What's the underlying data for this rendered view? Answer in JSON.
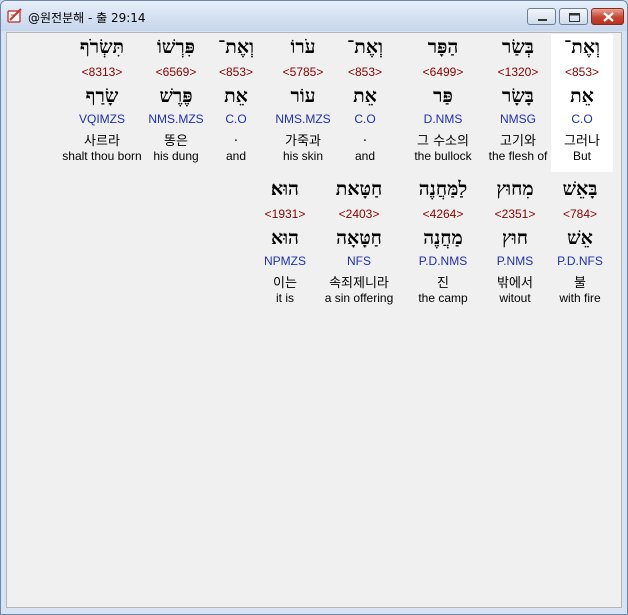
{
  "window": {
    "title": "@원전분해 - 출 29:14",
    "icon": "book-quill-icon",
    "controls": [
      "minimize-icon",
      "maximize-icon",
      "close-icon"
    ],
    "close_color": "#c64431"
  },
  "rows": [
    {
      "words": [
        {
          "hebrew": "וְאֶת־",
          "strong": "<853>",
          "lemma": "אֵת",
          "morph": "C.O",
          "korean": "그러나",
          "english": "But",
          "selected": true
        },
        {
          "hebrew": "בְּשַׂר",
          "strong": "<1320>",
          "lemma": "בָּשָׂר",
          "morph": "NMSG",
          "korean": "고기와",
          "english": "the flesh of",
          "selected": false
        },
        {
          "hebrew": "הַפָּר",
          "strong": "<6499>",
          "lemma": "פַּר",
          "morph": "D.NMS",
          "korean": "그 수소의",
          "english": "the bullock",
          "selected": false
        },
        {
          "hebrew": "וְאֶת־",
          "strong": "<853>",
          "lemma": "אֵת",
          "morph": "C.O",
          "korean": ".",
          "english": "and",
          "selected": false
        },
        {
          "hebrew": "עֹרוֹ",
          "strong": "<5785>",
          "lemma": "עוֹר",
          "morph": "NMS.MZS",
          "korean": "가죽과",
          "english": "his skin",
          "selected": false
        },
        {
          "hebrew": "וְאֶת־",
          "strong": "<853>",
          "lemma": "אֵת",
          "morph": "C.O",
          "korean": ".",
          "english": "and",
          "selected": false
        },
        {
          "hebrew": "פִּרְשׁוֹ",
          "strong": "<6569>",
          "lemma": "פֶּרֶשׁ",
          "morph": "NMS.MZS",
          "korean": "똥은",
          "english": "his dung",
          "selected": false
        },
        {
          "hebrew": "תִּשְׂרֹף",
          "strong": "<8313>",
          "lemma": "שָׂרַף",
          "morph": "VQIMZS",
          "korean": "사르라",
          "english": "shalt thou born",
          "selected": false
        }
      ]
    },
    {
      "words": [
        {
          "hebrew": "בָּאֵשׁ",
          "strong": "<784>",
          "lemma": "אֵשׁ",
          "morph": "P.D.NFS",
          "korean": "불",
          "english": "with fire",
          "selected": false
        },
        {
          "hebrew": "מִחוּץ",
          "strong": "<2351>",
          "lemma": "חוּץ",
          "morph": "P.NMS",
          "korean": "밖에서",
          "english": "witout",
          "selected": false
        },
        {
          "hebrew": "לַמַּחֲנֶה",
          "strong": "<4264>",
          "lemma": "מַחֲנֶה",
          "morph": "P.D.NMS",
          "korean": "진",
          "english": "the camp",
          "selected": false
        },
        {
          "hebrew": "חַטָּאת",
          "strong": "<2403>",
          "lemma": "חַטָּאָה",
          "morph": "NFS",
          "korean": "속죄제니라",
          "english": "a sin offering",
          "selected": false
        },
        {
          "hebrew": "הוּא׃",
          "strong": "<1931>",
          "lemma": "הוּא",
          "morph": "NPMZS",
          "korean": "이는",
          "english": "it is",
          "selected": false
        }
      ]
    }
  ]
}
